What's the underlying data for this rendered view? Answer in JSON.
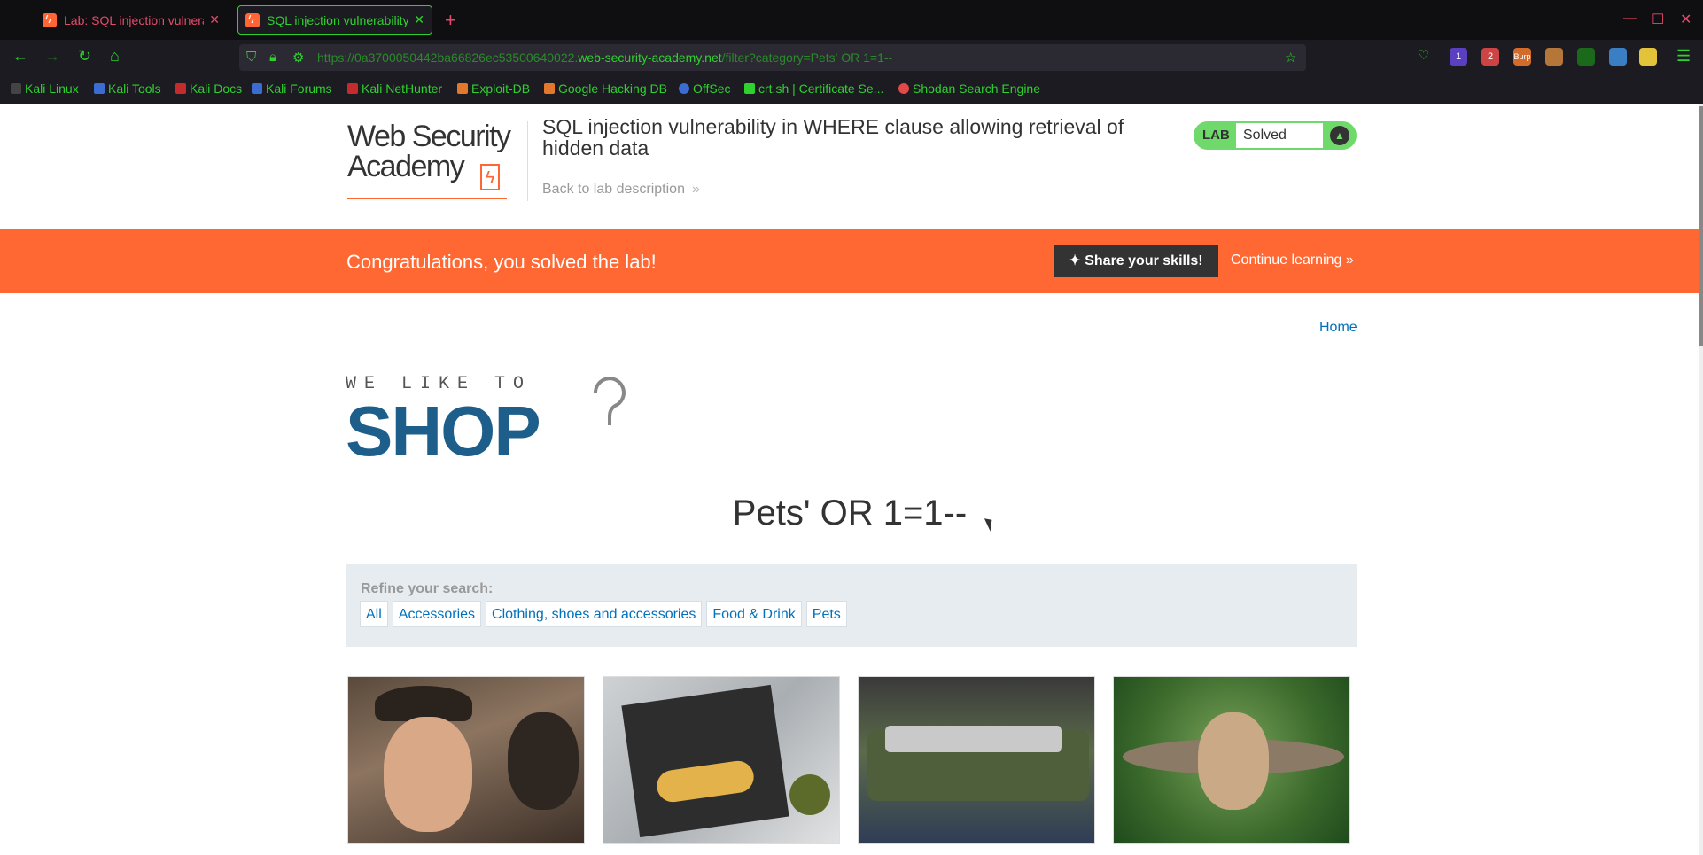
{
  "browser": {
    "tabs": [
      {
        "title": "Lab: SQL injection vulnerat",
        "active": false
      },
      {
        "title": "SQL injection vulnerability",
        "active": true
      }
    ],
    "url_prefix": "https://0a3700050442ba66826ec53500640022.",
    "url_host": "web-security-academy.net",
    "url_path": "/filter?category=Pets' OR 1=1--",
    "bookmarks": [
      "Kali Linux",
      "Kali Tools",
      "Kali Docs",
      "Kali Forums",
      "Kali NetHunter",
      "Exploit-DB",
      "Google Hacking DB",
      "OffSec",
      "crt.sh | Certificate Se...",
      "Shodan Search Engine"
    ],
    "extension_badges": [
      "1",
      "2",
      "Burp"
    ]
  },
  "academy": {
    "logo_line1": "Web Security",
    "logo_line2": "Academy",
    "lab_title": "SQL injection vulnerability in WHERE clause allowing retrieval of hidden data",
    "back_link": "Back to lab description",
    "status_label": "LAB",
    "status_value": "Solved"
  },
  "banner": {
    "message": "Congratulations, you solved the lab!",
    "share_label": "Share your skills!",
    "continue_label": "Continue learning"
  },
  "shop": {
    "home_label": "Home",
    "logo_small": "WE LIKE TO",
    "logo_big": "SHOP",
    "search_heading": "Pets' OR 1=1--",
    "refine_label": "Refine your search:",
    "filters": [
      "All",
      "Accessories",
      "Clothing, shoes and accessories",
      "Food & Drink",
      "Pets"
    ]
  },
  "colors": {
    "brand_orange": "#ff6832",
    "link_blue": "#0071bc",
    "solved_green": "#70d96b",
    "chrome_green": "#2fd12f"
  }
}
